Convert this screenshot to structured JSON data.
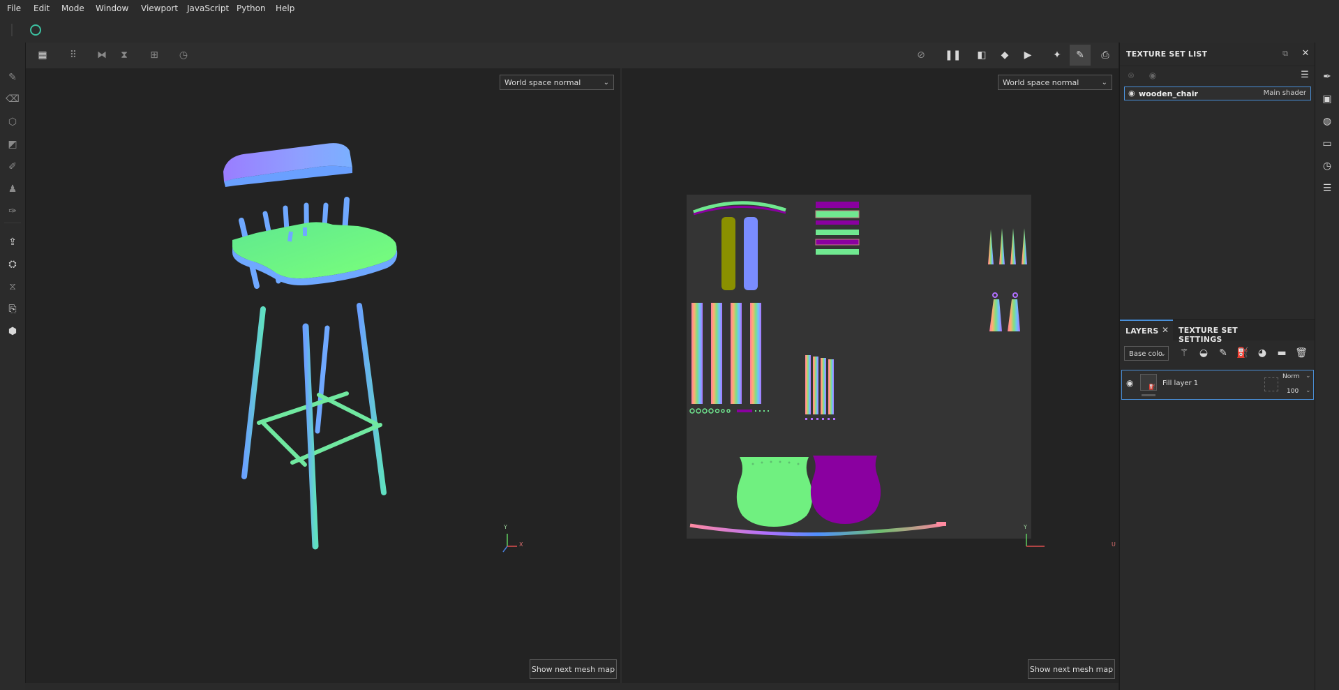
{
  "menu": [
    "File",
    "Edit",
    "Mode",
    "Window",
    "Viewport",
    "JavaScript",
    "Python",
    "Help"
  ],
  "viewport3d": {
    "mode_dropdown": "World space normal",
    "mesh_button": "Show next mesh map",
    "axis_y": "Y",
    "axis_x": "X"
  },
  "viewport2d": {
    "mode_dropdown": "World space normal",
    "mesh_button": "Show next mesh map",
    "axis_y": "Y",
    "axis_u": "U"
  },
  "texture_set_list": {
    "title": "TEXTURE SET LIST",
    "items": [
      {
        "name": "wooden_chair",
        "shader": "Main shader"
      }
    ]
  },
  "layers_panel": {
    "tabs": [
      "LAYERS",
      "TEXTURE SET SETTINGS"
    ],
    "channel_dropdown": "Base colo",
    "layers": [
      {
        "name": "Fill layer 1",
        "blend": "Norm",
        "opacity": "100"
      }
    ]
  },
  "colors": {
    "accent": "#4a90d9",
    "normal_green": "#6ff07a",
    "normal_blue": "#7a8cff",
    "normal_purple": "#8a00a0"
  }
}
